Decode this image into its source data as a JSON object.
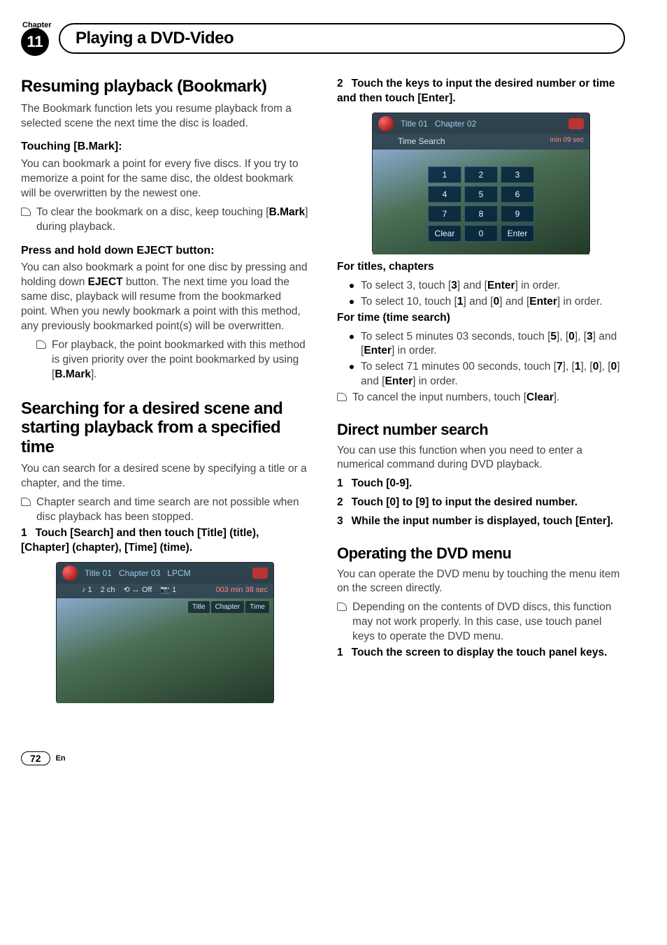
{
  "chapter": {
    "label": "Chapter",
    "number": "11"
  },
  "page_title": "Playing a DVD-Video",
  "left": {
    "h_resuming": "Resuming playback (Bookmark)",
    "resuming_intro": "The Bookmark function lets you resume playback from a selected scene the next time the disc is loaded.",
    "h_touching": "Touching [B.Mark]:",
    "touching_body": "You can bookmark a point for every five discs. If you try to memorize a point for the same disc, the oldest bookmark will be overwritten by the newest one.",
    "touching_bullet_pre": "To clear the bookmark on a disc, keep touching [",
    "touching_bullet_bold": "B.Mark",
    "touching_bullet_post": "] during playback.",
    "h_press": "Press and hold down EJECT button:",
    "press_body_pre": "You can also bookmark a point for one disc by pressing and holding down ",
    "press_body_bold": "EJECT",
    "press_body_post": " button. The next time you load the same disc, playback will resume from the bookmarked point. When you newly bookmark a point with this method, any previously bookmarked point(s) will be overwritten.",
    "press_bullet_pre": "For playback, the point bookmarked with this method is given priority over the point bookmarked by using [",
    "press_bullet_bold": "B.Mark",
    "press_bullet_post": "].",
    "h_searching": "Searching for a desired scene and starting playback from a specified time",
    "searching_body": "You can search for a desired scene by specifying a title or a chapter, and the time.",
    "searching_bullet": "Chapter search and time search are not possible when disc playback has been stopped.",
    "step1_num": "1",
    "step1": "Touch [Search] and then touch [Title] (title), [Chapter] (chapter), [Time] (time).",
    "sc1": {
      "title": "Title 01",
      "chapter": "Chapter 03",
      "codec": "LPCM",
      "track": "♪ 1",
      "ch": "2 ch",
      "repeat": "⟲ ↔ Off",
      "cam": "📷 1",
      "time": "003 min 38 sec",
      "tabs": [
        "Title",
        "Chapter",
        "Time"
      ]
    }
  },
  "right": {
    "step2_num": "2",
    "step2": "Touch the keys to input the desired number or time and then touch [Enter].",
    "sc2": {
      "title": "Title 01",
      "chapter": "Chapter 02",
      "mode": "Time Search",
      "time": "min 09 sec",
      "keys": [
        "1",
        "2",
        "3",
        "4",
        "5",
        "6",
        "7",
        "8",
        "9",
        "Clear",
        "0",
        "Enter"
      ]
    },
    "h_titles": "For titles, chapters",
    "titles_b1_pre": "To select 3, touch [",
    "titles_b1_k1": "3",
    "titles_b1_mid": "] and [",
    "titles_b1_k2": "Enter",
    "titles_b1_post": "] in order.",
    "titles_b2_pre": "To select 10, touch [",
    "titles_b2_k1": "1",
    "titles_b2_m1": "] and [",
    "titles_b2_k2": "0",
    "titles_b2_m2": "] and [",
    "titles_b2_k3": "Enter",
    "titles_b2_post": "] in order.",
    "h_time": "For time (time search)",
    "time_b1_pre": "To select 5 minutes 03 seconds, touch [",
    "time_b1_k1": "5",
    "time_b1_m1": "], [",
    "time_b1_k2": "0",
    "time_b1_m2": "], [",
    "time_b1_k3": "3",
    "time_b1_m3": "] and [",
    "time_b1_k4": "Enter",
    "time_b1_post": "] in order.",
    "time_b2_pre": "To select 71 minutes 00 seconds, touch [",
    "time_b2_k1": "7",
    "time_b2_m1": "], [",
    "time_b2_k2": "1",
    "time_b2_m2": "], [",
    "time_b2_k3": "0",
    "time_b2_m3": "], [",
    "time_b2_k4": "0",
    "time_b2_m4": "] and [",
    "time_b2_k5": "Enter",
    "time_b2_post": "] in order.",
    "time_b3_pre": "To cancel the input numbers, touch [",
    "time_b3_k": "Clear",
    "time_b3_post": "].",
    "h_direct": "Direct number search",
    "direct_body": "You can use this function when you need to enter a numerical command during DVD playback.",
    "d1_num": "1",
    "d1": "Touch [0-9].",
    "d2_num": "2",
    "d2": "Touch [0] to [9] to input the desired number.",
    "d3_num": "3",
    "d3": "While the input number is displayed, touch [Enter].",
    "h_menu": "Operating the DVD menu",
    "menu_body": "You can operate the DVD menu by touching the menu item on the screen directly.",
    "menu_bullet": "Depending on the contents of DVD discs, this function may not work properly. In this case, use touch panel keys to operate the DVD menu.",
    "m1_num": "1",
    "m1": "Touch the screen to display the touch panel keys."
  },
  "footer": {
    "page": "72",
    "lang": "En"
  }
}
